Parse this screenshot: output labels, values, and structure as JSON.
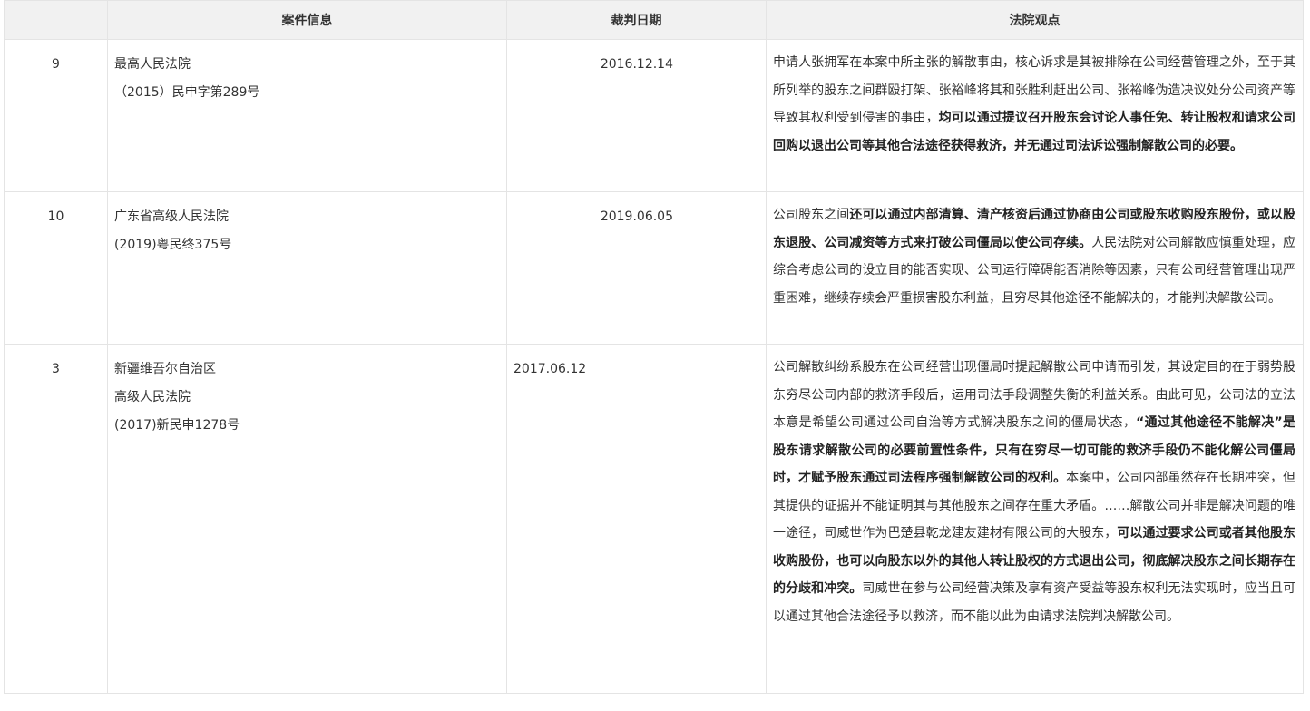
{
  "headers": {
    "col1": "",
    "col2": "案件信息",
    "col3": "裁判日期",
    "col4": "法院观点"
  },
  "rows": [
    {
      "index": "9",
      "court_lines": [
        "最高人民法院",
        "（2015）民申字第289号"
      ],
      "date": "2016.12.14",
      "view": [
        {
          "text": "申请人张拥军在本案中所主张的解散事由，核心诉求是其被排除在公司经营管理之外，至于其所列举的股东之间群殴打架、张裕峰将其和张胜利赶出公司、张裕峰伪造决议处分公司资产等导致其权利受到侵害的事由，",
          "bold": false
        },
        {
          "text": "均可以通过提议召开股东会讨论人事任免、转让股权和请求公司回购以退出公司等其他合法途径获得救济，并无通过司法诉讼强制解散公司的必要。",
          "bold": true
        }
      ]
    },
    {
      "index": "10",
      "court_lines": [
        "广东省高级人民法院",
        "(2019)粤民终375号"
      ],
      "date": "2019.06.05",
      "view": [
        {
          "text": "公司股东之间",
          "bold": false
        },
        {
          "text": "还可以通过内部清算、清产核资后通过协商由公司或股东收购股东股份，或以股东退股、公司减资等方式来打破公司僵局以使公司存续。",
          "bold": true
        },
        {
          "text": "人民法院对公司解散应慎重处理，应综合考虑公司的设立目的能否实现、公司运行障碍能否消除等因素，只有公司经营管理出现严重困难，继续存续会严重损害股东利益，且穷尽其他途径不能解决的，才能判决解散公司。",
          "bold": false
        }
      ]
    },
    {
      "index": "3",
      "court_lines": [
        "新疆维吾尔自治区",
        "高级人民法院",
        "(2017)新民申1278号"
      ],
      "date": "2017.06.12",
      "view": [
        {
          "text": "公司解散纠纷系股东在公司经营出现僵局时提起解散公司申请而引发，其设定目的在于弱势股东穷尽公司内部的救济手段后，运用司法手段调整失衡的利益关系。由此可见，公司法的立法本意是希望公司通过公司自治等方式解决股东之间的僵局状态，",
          "bold": false
        },
        {
          "text": "“通过其他途径不能解决”是股东请求解散公司的必要前置性条件，只有在穷尽一切可能的救济手段仍不能化解公司僵局时，才赋予股东通过司法程序强制解散公司的权利。",
          "bold": true
        },
        {
          "text": "本案中，公司内部虽然存在长期冲突，但其提供的证据并不能证明其与其他股东之间存在重大矛盾。……解散公司并非是解决问题的唯一途径，司威世作为巴楚县乾龙建友建材有限公司的大股东，",
          "bold": false
        },
        {
          "text": "可以通过要求公司或者其他股东收购股份，也可以向股东以外的其他人转让股权的方式退出公司，彻底解决股东之间长期存在的分歧和冲突。",
          "bold": true
        },
        {
          "text": "司威世在参与公司经营决策及享有资产受益等股东权利无法实现时，应当且可以通过其他合法途径予以救济，而不能以此为由请求法院判决解散公司。",
          "bold": false
        }
      ]
    }
  ]
}
